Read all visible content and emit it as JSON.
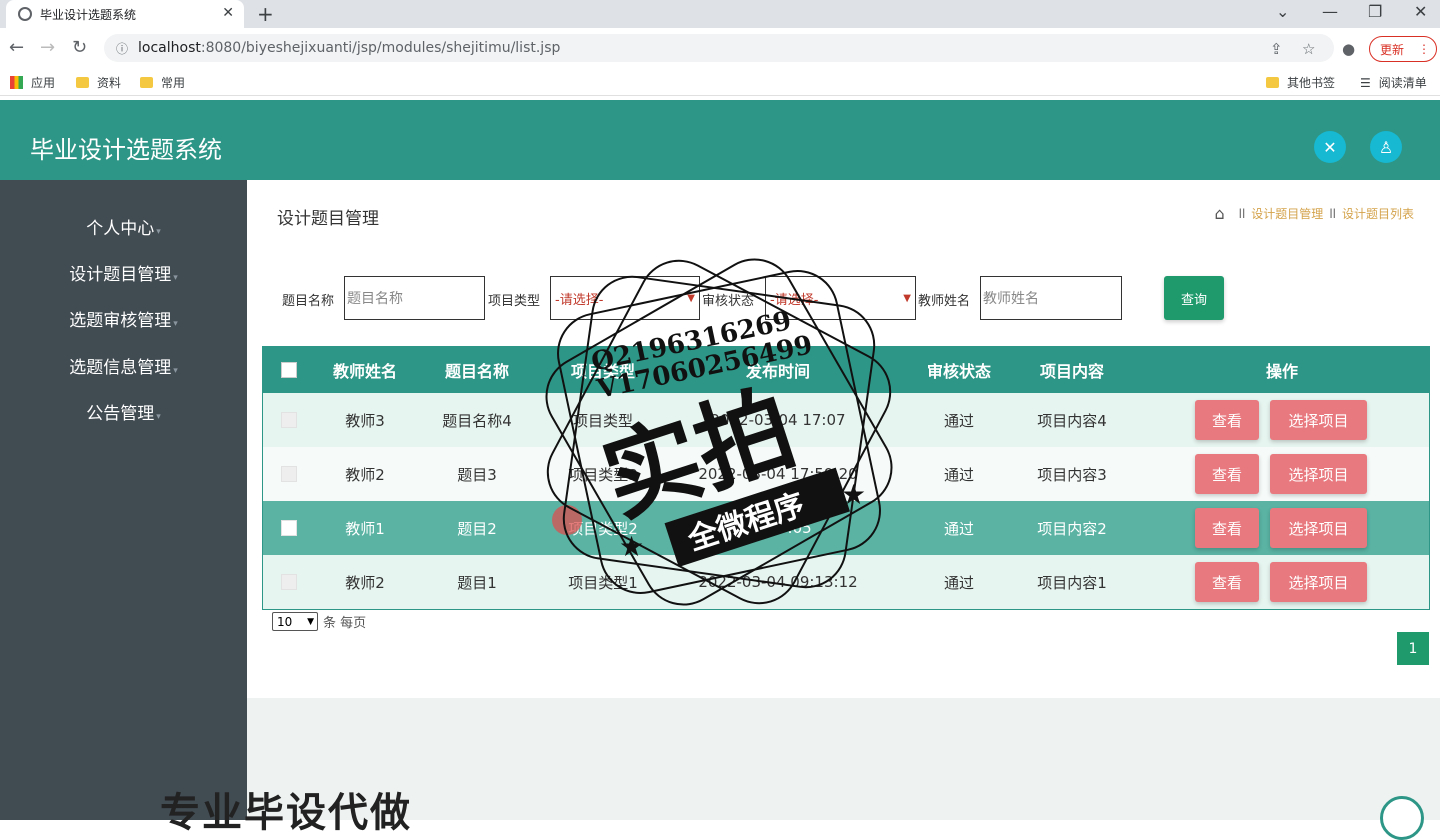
{
  "browser": {
    "tab_title": "毕业设计选题系统",
    "url_host": "localhost",
    "url_path": ":8080/biyeshejixuanti/jsp/modules/shejitimu/list.jsp",
    "update_label": "更新",
    "bookmarks": [
      "应用",
      "资料",
      "常用"
    ],
    "bookmarks_right": [
      "其他书签",
      "阅读清单"
    ]
  },
  "header": {
    "title": "毕业设计选题系统"
  },
  "sidebar": {
    "items": [
      {
        "label": "个人中心"
      },
      {
        "label": "设计题目管理"
      },
      {
        "label": "选题审核管理"
      },
      {
        "label": "选题信息管理"
      },
      {
        "label": "公告管理"
      }
    ]
  },
  "page": {
    "title": "设计题目管理",
    "breadcrumb": [
      "设计题目管理",
      "设计题目列表"
    ]
  },
  "filters": {
    "title_label": "题目名称",
    "title_placeholder": "题目名称",
    "type_label": "项目类型",
    "type_value": "-请选择-",
    "audit_label": "审核状态",
    "audit_value": "-请选择-",
    "teacher_label": "教师姓名",
    "teacher_placeholder": "教师姓名",
    "query_button": "查询"
  },
  "table": {
    "columns": [
      "教师姓名",
      "题目名称",
      "项目类型",
      "发布时间",
      "审核状态",
      "项目内容",
      "操作"
    ],
    "rows": [
      {
        "teacher": "教师3",
        "title": "题目名称4",
        "type": "项目类型",
        "time": "2022-03-04 17:07",
        "status": "通过",
        "content": "项目内容4"
      },
      {
        "teacher": "教师2",
        "title": "题目3",
        "type": "项目类型3",
        "time": "2022-03-04 17:59:20",
        "status": "通过",
        "content": "项目内容3"
      },
      {
        "teacher": "教师1",
        "title": "题目2",
        "type": "项目类型2",
        "time": "11:39:05",
        "status": "通过",
        "content": "项目内容2"
      },
      {
        "teacher": "教师2",
        "title": "题目1",
        "type": "项目类型1",
        "time": "2022-03-04 09:13:12",
        "status": "通过",
        "content": "项目内容1"
      }
    ],
    "view_label": "查看",
    "pick_label": "选择项目"
  },
  "pagination": {
    "page_size": "10",
    "page_size_suffix": "条 每页",
    "current_page": "1"
  },
  "watermark": {
    "line1": "Q2196316269",
    "line2": "V17060256499",
    "big": "实拍",
    "sub": "全微程序"
  },
  "banner": "专业毕设代做"
}
